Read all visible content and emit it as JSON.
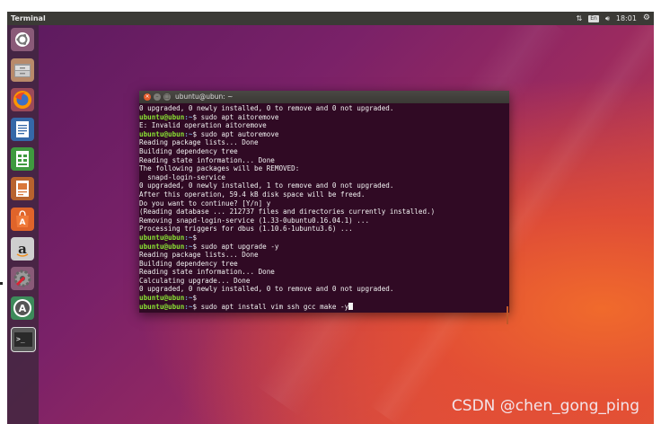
{
  "topbar": {
    "app_title": "Terminal",
    "keyboard_layout": "En",
    "time": "18:01",
    "icons": [
      "network-updown-icon",
      "keyboard-icon",
      "volume-icon",
      "settings-gear-icon"
    ]
  },
  "launcher": {
    "items": [
      {
        "name": "ubuntu-dash-icon"
      },
      {
        "name": "files-icon"
      },
      {
        "name": "firefox-icon"
      },
      {
        "name": "libreoffice-writer-icon"
      },
      {
        "name": "libreoffice-calc-icon"
      },
      {
        "name": "libreoffice-impress-icon"
      },
      {
        "name": "ubuntu-software-icon"
      },
      {
        "name": "amazon-icon"
      },
      {
        "name": "system-settings-icon"
      },
      {
        "name": "software-updater-icon"
      },
      {
        "name": "terminal-icon"
      }
    ]
  },
  "terminal": {
    "window_title": "ubuntu@ubun: ~",
    "prompt_user": "ubuntu@ubun",
    "prompt_path": ":~",
    "lines": [
      {
        "type": "out",
        "text": "0 upgraded, 0 newly installed, 0 to remove and 0 not upgraded."
      },
      {
        "type": "cmd",
        "text": "$ sudo apt aitoremove"
      },
      {
        "type": "out",
        "text": "E: Invalid operation aitoremove"
      },
      {
        "type": "cmd",
        "text": "$ sudo apt autoremove"
      },
      {
        "type": "out",
        "text": "Reading package lists... Done"
      },
      {
        "type": "out",
        "text": "Building dependency tree"
      },
      {
        "type": "out",
        "text": "Reading state information... Done"
      },
      {
        "type": "out",
        "text": "The following packages will be REMOVED:"
      },
      {
        "type": "out",
        "text": "  snapd-login-service"
      },
      {
        "type": "out",
        "text": "0 upgraded, 0 newly installed, 1 to remove and 0 not upgraded."
      },
      {
        "type": "out",
        "text": "After this operation, 59.4 kB disk space will be freed."
      },
      {
        "type": "out",
        "text": "Do you want to continue? [Y/n] y"
      },
      {
        "type": "out",
        "text": "(Reading database ... 212737 files and directories currently installed.)"
      },
      {
        "type": "out",
        "text": "Removing snapd-login-service (1.33-0ubuntu0.16.04.1) ..."
      },
      {
        "type": "out",
        "text": "Processing triggers for dbus (1.10.6-1ubuntu3.6) ..."
      },
      {
        "type": "cmd",
        "text": "$"
      },
      {
        "type": "cmd",
        "text": "$ sudo apt upgrade -y"
      },
      {
        "type": "out",
        "text": "Reading package lists... Done"
      },
      {
        "type": "out",
        "text": "Building dependency tree"
      },
      {
        "type": "out",
        "text": "Reading state information... Done"
      },
      {
        "type": "out",
        "text": "Calculating upgrade... Done"
      },
      {
        "type": "out",
        "text": "0 upgraded, 0 newly installed, 0 to remove and 0 not upgraded."
      },
      {
        "type": "cmd",
        "text": "$"
      },
      {
        "type": "cmd",
        "text": "$ sudo apt install vim ssh gcc make -y"
      }
    ]
  },
  "watermark": "CSDN @chen_gong_ping"
}
